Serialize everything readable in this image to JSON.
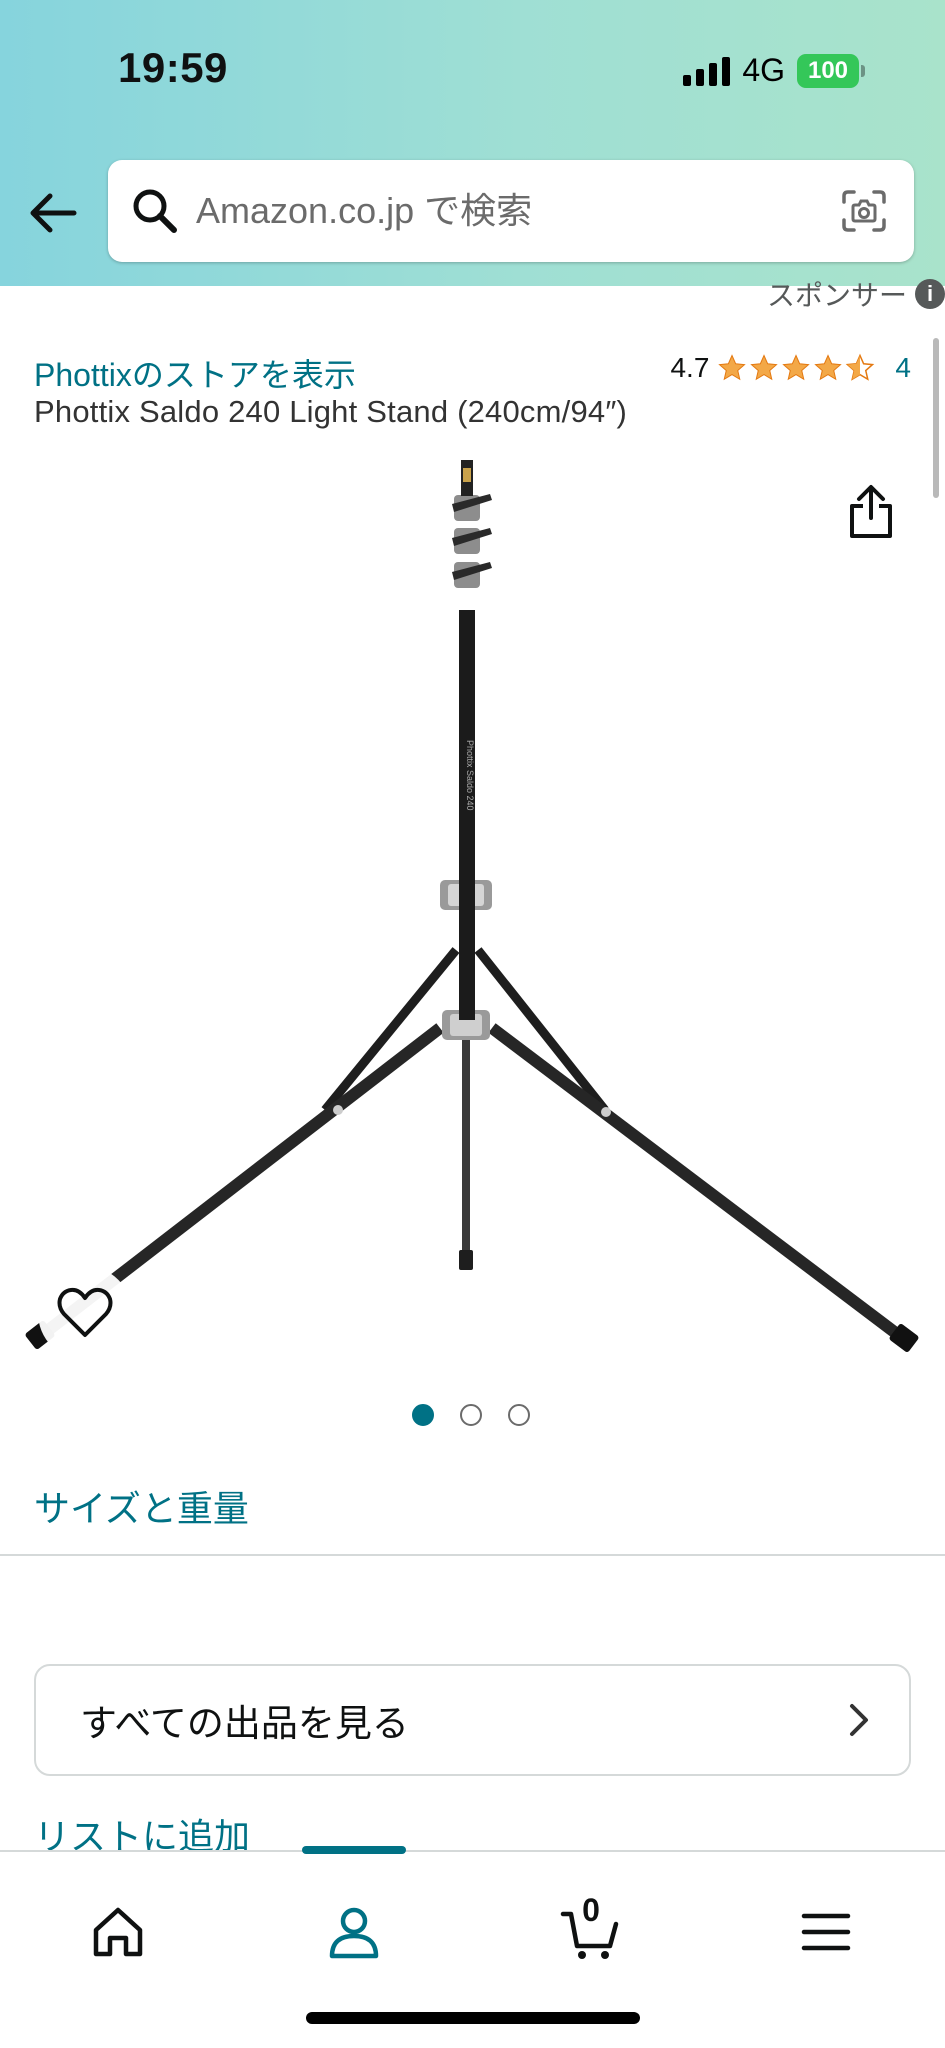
{
  "status_bar": {
    "time": "19:59",
    "network": "4G",
    "battery": "100"
  },
  "search": {
    "placeholder": "Amazon.co.jp で検索"
  },
  "sponsored": {
    "label": "スポンサー"
  },
  "product": {
    "store_link": "Phottixのストアを表示",
    "rating_value": "4.7",
    "rating_stars": 4.5,
    "rating_count": "4",
    "title": "Phottix Saldo 240 Light Stand (240cm/94″)",
    "image_label": "Phottix Saldo 240"
  },
  "carousel": {
    "total_images": 3,
    "active_index": 0
  },
  "sections": {
    "size_weight": "サイズと重量",
    "all_offers": "すべての出品を見る",
    "add_to_list": "リストに追加"
  },
  "bottom_nav": {
    "items": [
      "home-icon",
      "account-icon",
      "cart-icon",
      "menu-icon"
    ],
    "active": "account-icon",
    "cart_count": "0"
  },
  "colors": {
    "link": "#007185",
    "star": "#f3a847",
    "battery": "#34c759"
  }
}
